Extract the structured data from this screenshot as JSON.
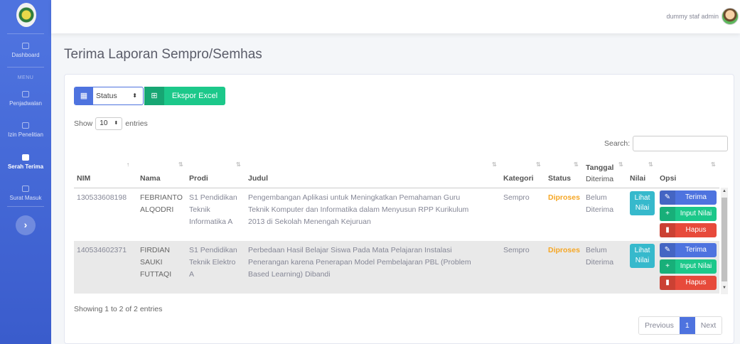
{
  "sidebar": {
    "items": [
      {
        "label": "Dashboard",
        "icon": "dashboard-icon"
      },
      {
        "label": "Penjadwalan",
        "icon": "calendar-icon"
      },
      {
        "label": "Izin Penelitian",
        "icon": "users-icon"
      },
      {
        "label": "Serah Terima",
        "icon": "file-icon",
        "active": true
      },
      {
        "label": "Surat Masuk",
        "icon": "mail-icon"
      }
    ],
    "menu_heading": "MENU",
    "toggle_glyph": "›"
  },
  "topbar": {
    "user_name": "dummy staf admin"
  },
  "page": {
    "title": "Terima Laporan Sempro/Semhas"
  },
  "filters": {
    "status_selected": "Status",
    "export_label": "Ekspor Excel"
  },
  "datatable": {
    "show_label": "Show",
    "length_selected": "10",
    "entries_label": "entries",
    "search_label": "Search:",
    "info": "Showing 1 to 2 of 2 entries",
    "pager": {
      "previous": "Previous",
      "current": "1",
      "next": "Next"
    }
  },
  "table": {
    "columns": [
      "NIM",
      "Nama",
      "Prodi",
      "Judul",
      "Kategori",
      "Status",
      "Tanggal",
      "Diterima",
      "Nilai",
      "Opsi"
    ],
    "rows": [
      {
        "nim": "130533608198",
        "nama": [
          "FEBRIANTO",
          "ALQODRI"
        ],
        "prodi": [
          "S1 Pendidikan",
          "Teknik",
          "Informatika A"
        ],
        "judul": [
          "Pengembangan Aplikasi untuk Meningkatkan Pemahaman Guru",
          "Teknik Komputer dan Informatika dalam Menyusun RPP Kurikulum",
          "2013 di Sekolah Menengah Kejuruan"
        ],
        "kategori": "Sempro",
        "status": "Diproses",
        "tanggal": [
          "Belum",
          "Diterima"
        ],
        "nilai_btn": [
          "Lihat",
          "Nilai"
        ],
        "opsi": [
          "Terima",
          "Input Nilai",
          "Hapus"
        ]
      },
      {
        "nim": "140534602371",
        "nama": [
          "FIRDIAN",
          "SAUKI",
          "FUTTAQI"
        ],
        "prodi": [
          "S1 Pendidikan",
          "Teknik Elektro",
          "A"
        ],
        "judul": [
          "Perbedaan Hasil Belajar Siswa Pada Mata Pelajaran Instalasi",
          "Penerangan karena Penerapan Model Pembelajaran PBL (Problem",
          "Based Learning) Dibandi"
        ],
        "kategori": "Sempro",
        "status": "Diproses",
        "tanggal": [
          "Belum",
          "Diterima"
        ],
        "nilai_btn": [
          "Lihat",
          "Nilai"
        ],
        "opsi": [
          "Terima",
          "Input Nilai",
          "Hapus"
        ]
      }
    ]
  },
  "colors": {
    "primary": "#4e73df",
    "success": "#1cc88a",
    "danger": "#e74a3b",
    "info": "#36b9cc",
    "warning": "#f6a623"
  }
}
